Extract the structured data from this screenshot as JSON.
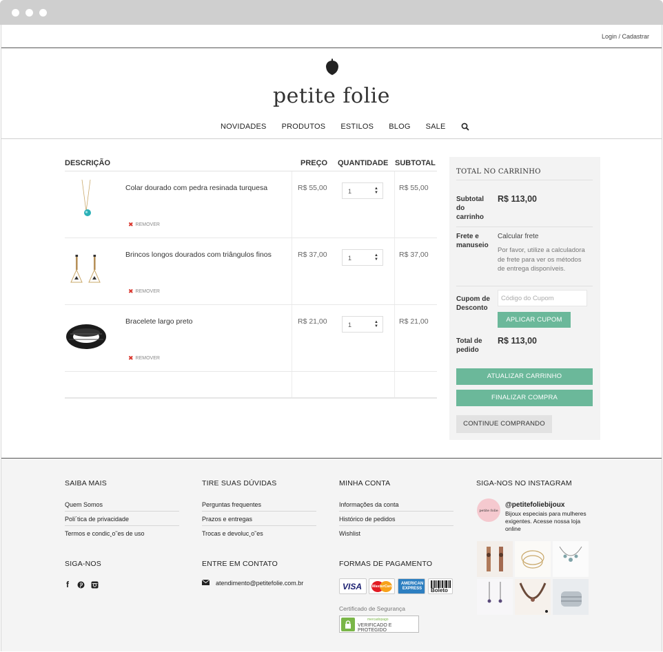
{
  "header": {
    "login_link": "Login / Cadastrar",
    "brand": "petite folie",
    "nav": [
      "NOVIDADES",
      "PRODUTOS",
      "ESTILOS",
      "BLOG",
      "SALE"
    ],
    "search_icon": "search-icon"
  },
  "cart": {
    "columns": {
      "description": "DESCRIÇÃO",
      "price": "PREÇO",
      "quantity": "QUANTIDADE",
      "subtotal": "SUBTOTAL"
    },
    "remove_label": "REMOVER",
    "items": [
      {
        "name": "Colar dourado com pedra resinada turquesa",
        "price": "R$ 55,00",
        "qty": "1",
        "subtotal": "R$ 55,00"
      },
      {
        "name": "Brincos longos dourados com triângulos finos",
        "price": "R$ 37,00",
        "qty": "1",
        "subtotal": "R$ 37,00"
      },
      {
        "name": "Bracelete largo preto",
        "price": "R$ 21,00",
        "qty": "1",
        "subtotal": "R$ 21,00"
      }
    ]
  },
  "totals": {
    "title": "TOTAL NO CARRINHO",
    "subtotal_label": "Subtotal do carrinho",
    "subtotal_value": "R$ 113,00",
    "shipping_label": "Frete e manuseio",
    "shipping_link": "Calcular frete",
    "shipping_note": "Por favor, utilize a calculadora de frete para ver os métodos de entrega disponíveis.",
    "coupon_label": "Cupom de Desconto",
    "coupon_placeholder": "Código do Cupom",
    "apply_coupon": "APLICAR CUPOM",
    "total_label": "Total de pedido",
    "total_value": "R$ 113,00",
    "update_cart": "ATUALIZAR CARRINHO",
    "checkout": "FINALIZAR COMPRA",
    "continue": "CONTINUE COMPRANDO"
  },
  "footer": {
    "saiba_mais": {
      "title": "SAIBA MAIS",
      "links": [
        "Quem Somos",
        "Poli´tica de privacidade",
        "Termos e condic¸o˜es de uso"
      ]
    },
    "duvidas": {
      "title": "TIRE SUAS DÚVIDAS",
      "links": [
        "Perguntas frequentes",
        "Prazos e entregas",
        "Trocas e devoluc¸o˜es"
      ]
    },
    "conta": {
      "title": "MINHA CONTA",
      "links": [
        "Informações da conta",
        "Histórico de pedidos",
        "Wishlist"
      ]
    },
    "instagram": {
      "title": "SIGA-NOS NO INSTAGRAM",
      "handle": "@petitefoliebijoux",
      "bio": "Bijoux especiais para mulheres exigentes. Acesse nossa loja online",
      "avatar_text": "petite folie"
    },
    "siga": {
      "title": "SIGA-NOS",
      "icons": [
        "facebook-icon",
        "pinterest-icon",
        "instagram-icon"
      ]
    },
    "contato": {
      "title": "ENTRE EM CONTATO",
      "email": "atendimento@petitefolie.com.br"
    },
    "pagamento": {
      "title": "FORMAS DE PAGAMENTO",
      "methods": [
        "VISA",
        "MasterCard",
        "AMERICAN EXPRESS",
        "Boleto"
      ],
      "cert_label": "Certificado de Segurança",
      "cert_badge": "VERIFICADO E PROTEGIDO",
      "cert_top": "mercadopago"
    }
  }
}
